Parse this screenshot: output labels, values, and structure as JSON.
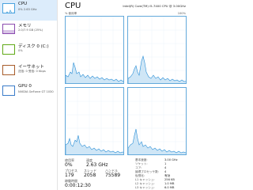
{
  "sidebar": {
    "items": [
      {
        "title": "CPU",
        "subtitle": "0% 2.63 GHz"
      },
      {
        "title": "メモリ",
        "subtitle": "2.0/7.9 GB (25%)"
      },
      {
        "title": "ディスク 0 (C:)",
        "subtitle": "0%"
      },
      {
        "title": "イーサネット",
        "subtitle": "送信: 0 受信: 0 Kbps"
      },
      {
        "title": "GPU 0",
        "subtitle": "NVIDIA GeForce GT 1030"
      }
    ]
  },
  "header": {
    "title": "CPU",
    "model": "Intel(R) Core(TM) i5-7400 CPU @ 3.00GHz",
    "util_label": "% 使用率",
    "max_label": "100%"
  },
  "stats": {
    "usage_label": "使用率",
    "usage_value": "0%",
    "speed_label": "速度",
    "speed_value": "2.63 GHz",
    "proc_label": "プロセス",
    "proc_value": "179",
    "thread_label": "スレッド",
    "thread_value": "2058",
    "handle_label": "ハンドル",
    "handle_value": "75589",
    "uptime_label": "稼働時間",
    "uptime_value": "0:00:12:30"
  },
  "specs": [
    {
      "label": "基本速度:",
      "value": "3.00 GHz"
    },
    {
      "label": "ソケット:",
      "value": "1"
    },
    {
      "label": "コア:",
      "value": "4"
    },
    {
      "label": "論理プロセッサ数:",
      "value": "4"
    },
    {
      "label": "仮想化:",
      "value": "有効"
    },
    {
      "label": "L1 キャッシュ:",
      "value": "256 KB"
    },
    {
      "label": "L2 キャッシュ:",
      "value": "1.0 MB"
    },
    {
      "label": "L3 キャッシュ:",
      "value": "6.0 MB"
    }
  ],
  "colors": {
    "accent": "#4aa3df",
    "graph_fill": "#cfe6f6",
    "graph_line": "#2c8fd6",
    "selected_bg": "#dcecfb"
  }
}
